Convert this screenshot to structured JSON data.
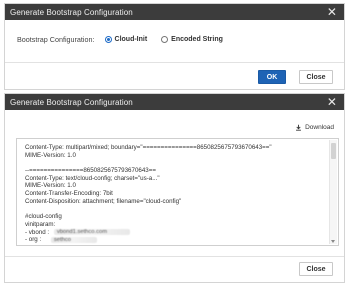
{
  "dialog1": {
    "title": "Generate Bootstrap Configuration",
    "config_label": "Bootstrap Configuration:",
    "options": [
      {
        "label": "Cloud-Init",
        "selected": true
      },
      {
        "label": "Encoded String",
        "selected": false
      }
    ],
    "ok_label": "OK",
    "close_label": "Close"
  },
  "dialog2": {
    "title": "Generate Bootstrap Configuration",
    "download_label": "Download",
    "lines": [
      "Content-Type: multipart/mixed; boundary=\"===============8650825675793670643==\"",
      "MIME-Version: 1.0",
      "",
      "--===============8650825675793670643==",
      "Content-Type: text/cloud-config; charset=\"us-a...\"",
      "MIME-Version: 1.0",
      "Content-Transfer-Encoding: 7bit",
      "Content-Disposition: attachment; filename=\"cloud-config\"",
      "",
      "#cloud-config",
      "vinitparam:",
      " - vbond :",
      " - org :"
    ],
    "vbond_value": "vbond1.sethco.com",
    "org_value": "sethco",
    "close_label": "Close"
  },
  "colors": {
    "titlebar": "#3c3c3c",
    "primary": "#1e63b5"
  },
  "icons": {
    "close": "close-icon",
    "download": "download-icon"
  }
}
